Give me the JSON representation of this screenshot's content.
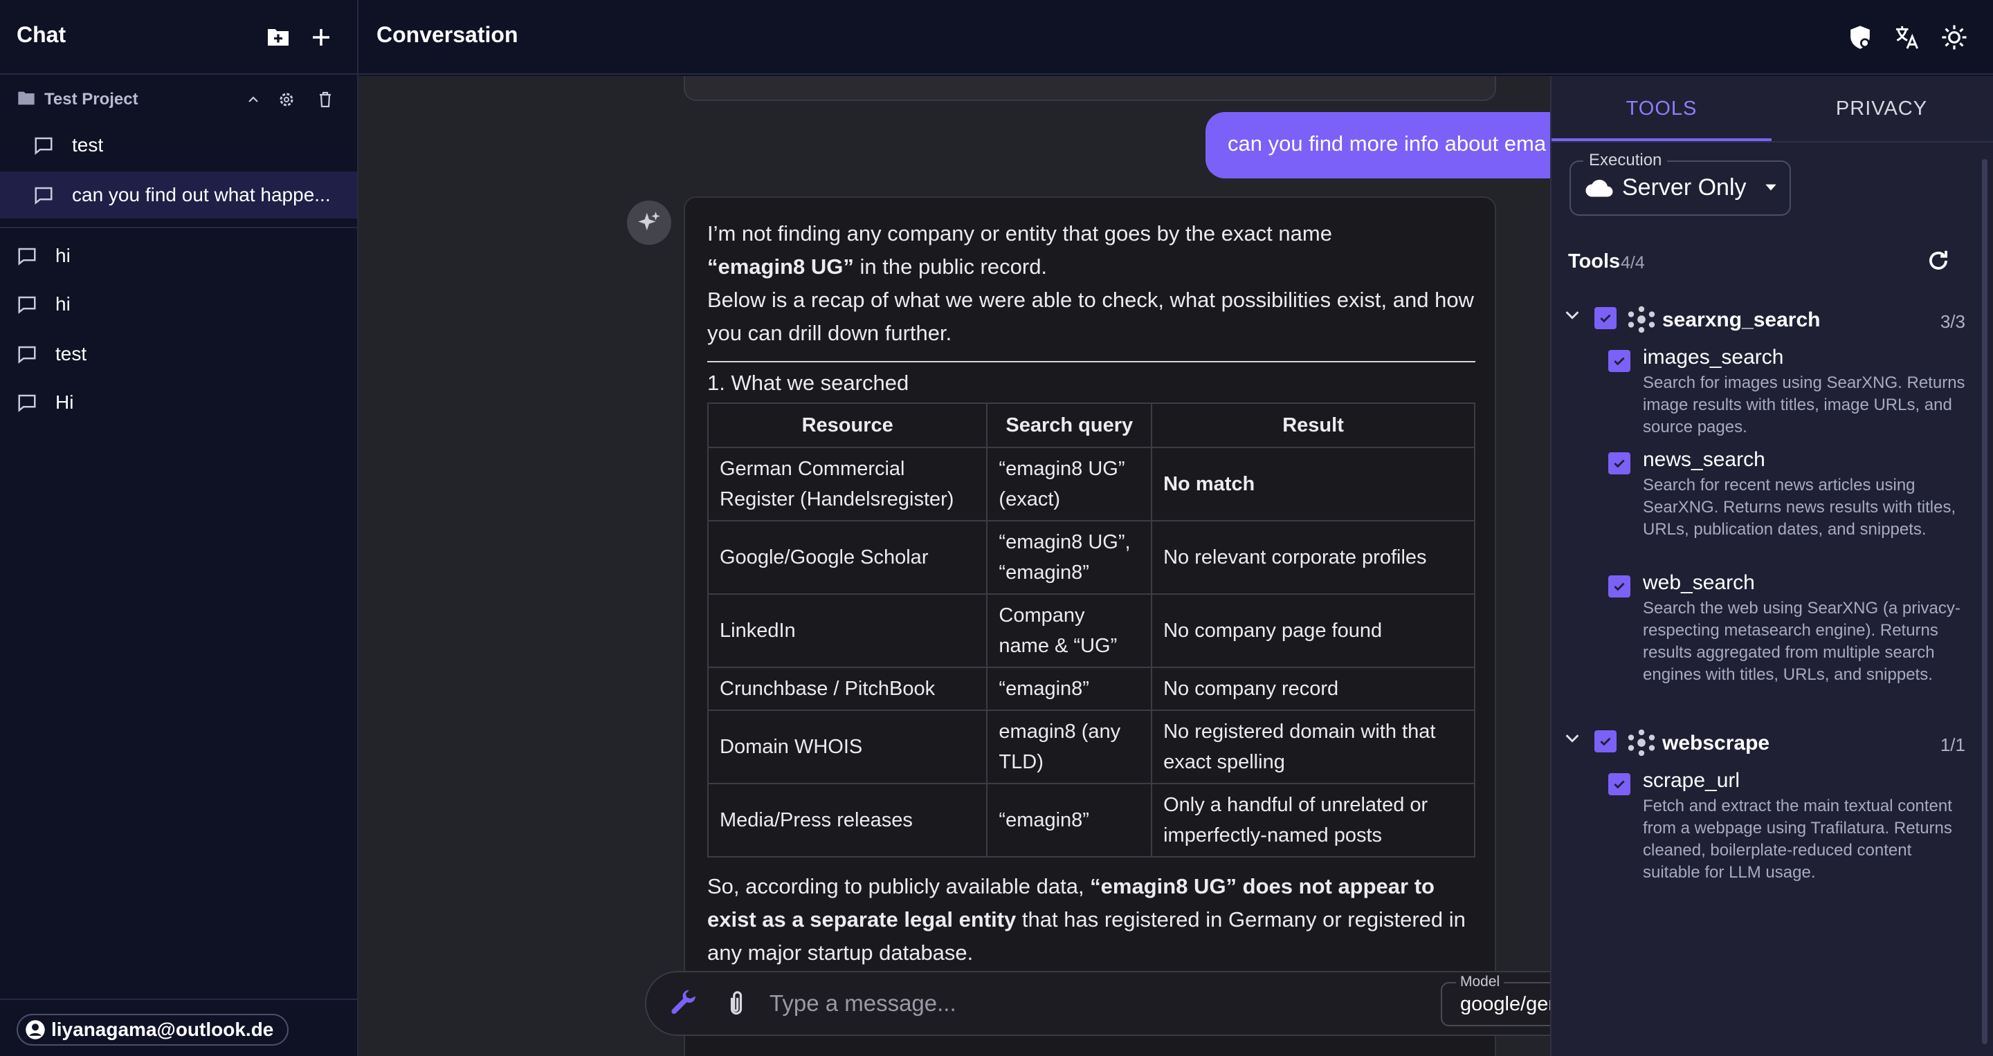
{
  "sidebar": {
    "title": "Chat",
    "project": {
      "name": "Test Project"
    },
    "project_chats": [
      "test",
      "can you find out what happe..."
    ],
    "chats": [
      "hi",
      "hi",
      "test",
      "Hi"
    ],
    "user_email": "liyanagama@outlook.de"
  },
  "header": {
    "title": "Conversation"
  },
  "conversation": {
    "user_message": "can you find more info about ema",
    "assistant": {
      "intro_line1": "I’m not finding any company or entity that goes by the exact name",
      "intro_bold": "“emagin8 UG”",
      "intro_line2": " in the public record.",
      "recap": "Below is a recap of what we were able to check, what possibilities exist, and how you can drill down further.",
      "section_heading": "1. What we searched",
      "table": {
        "headers": [
          "Resource",
          "Search query",
          "Result"
        ],
        "rows": [
          [
            "German Commercial Register (Handelsregister)",
            "“emagin8 UG” (exact)",
            "No match"
          ],
          [
            "Google/Google Scholar",
            "“emagin8 UG”, “emagin8”",
            "No relevant corporate profiles"
          ],
          [
            "LinkedIn",
            "Company name & “UG”",
            "No company page found"
          ],
          [
            "Crunchbase / PitchBook",
            "“emagin8”",
            "No company record"
          ],
          [
            "Domain WHOIS",
            "emagin8 (any TLD)",
            "No registered domain with that exact spelling"
          ],
          [
            "Media/Press releases",
            "“emagin8”",
            "Only a handful of unrelated or imperfectly-named posts"
          ]
        ]
      },
      "summary_prefix": "So, according to publicly available data, ",
      "summary_bold": "“emagin8 UG” does not appear to exist as a separate legal entity",
      "summary_suffix": " that has registered in Germany or registered in any major startup database."
    }
  },
  "input": {
    "placeholder": "Type a message...",
    "model_label": "Model",
    "model_value": "google/gemini"
  },
  "tools_panel": {
    "tabs": [
      "TOOLS",
      "PRIVACY"
    ],
    "active_tab": "TOOLS",
    "execution_label": "Execution",
    "execution_value": "Server Only",
    "tools_label": "Tools",
    "tools_count": "4/4",
    "groups": [
      {
        "name": "searxng_search",
        "count": "3/3",
        "tools": [
          {
            "name": "images_search",
            "desc": "Search for images using SearXNG. Returns image results with titles, image URLs, and source pages."
          },
          {
            "name": "news_search",
            "desc": "Search for recent news articles using SearXNG. Returns news results with titles, URLs, publication dates, and snippets."
          },
          {
            "name": "web_search",
            "desc": "Search the web using SearXNG (a privacy-respecting metasearch engine). Returns results aggregated from multiple search engines with titles, URLs, and snippets."
          }
        ]
      },
      {
        "name": "webscrape",
        "count": "1/1",
        "tools": [
          {
            "name": "scrape_url",
            "desc": "Fetch and extract the main textual content from a webpage using Trafilatura. Returns cleaned, boilerplate-reduced content suitable for LLM usage."
          }
        ]
      }
    ]
  },
  "colors": {
    "accent": "#7b61f7",
    "sidebar_bg": "#0f1224",
    "chat_bg": "#23232a",
    "panel_bg": "#1f2033"
  }
}
